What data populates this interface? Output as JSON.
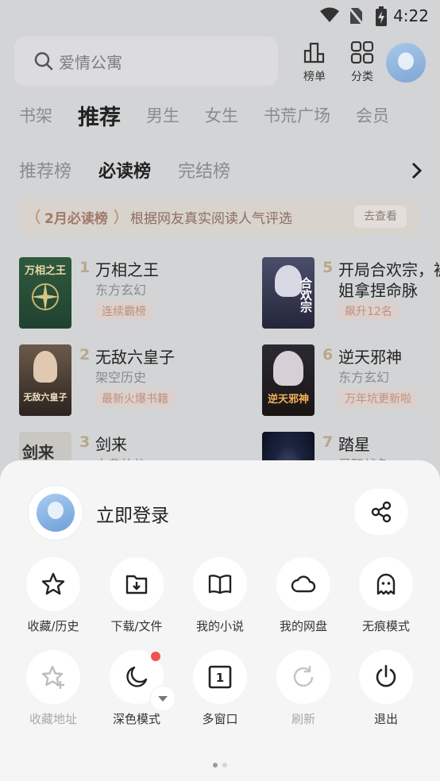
{
  "status_bar": {
    "time": "4:22"
  },
  "search": {
    "placeholder": "爱情公寓"
  },
  "top_buttons": {
    "rank_label": "榜单",
    "category_label": "分类"
  },
  "tabs": [
    "书架",
    "推荐",
    "男生",
    "女生",
    "书荒广场",
    "会员"
  ],
  "active_tab": "推荐",
  "sub_tabs": [
    "推荐榜",
    "必读榜",
    "完结榜"
  ],
  "active_sub_tab": "必读榜",
  "banner": {
    "title": "2月必读榜",
    "subtitle": "根据网友真实阅读人气评选",
    "button": "去查看"
  },
  "books": [
    {
      "rank": "1",
      "title": "万相之王",
      "category": "东方玄幻",
      "tag": "连续霸榜",
      "cover_text": "万相之王"
    },
    {
      "rank": "2",
      "title": "无敌六皇子",
      "category": "架空历史",
      "tag": "最新火爆书籍",
      "cover_text": "无敌六皇子"
    },
    {
      "rank": "3",
      "title": "剑来",
      "category": "古典仙侠",
      "tag": "",
      "cover_text": "剑来"
    },
    {
      "rank": "5",
      "title": "开局合欢宗，被",
      "title2": "姐拿捏命脉",
      "category": "",
      "tag": "飙升12名",
      "cover_text": "合欢宗"
    },
    {
      "rank": "6",
      "title": "逆天邪神",
      "category": "东方玄幻",
      "tag": "万年坑更新啦",
      "cover_text": "逆天邪神"
    },
    {
      "rank": "7",
      "title": "踏星",
      "category": "星际战争",
      "tag": "",
      "cover_text": ""
    }
  ],
  "sheet": {
    "login_label": "立即登录",
    "row1": [
      {
        "label": "收藏/历史",
        "icon": "star-icon"
      },
      {
        "label": "下载/文件",
        "icon": "download-folder-icon"
      },
      {
        "label": "我的小说",
        "icon": "book-icon"
      },
      {
        "label": "我的网盘",
        "icon": "cloud-icon"
      },
      {
        "label": "无痕模式",
        "icon": "ghost-icon"
      }
    ],
    "row2": [
      {
        "label": "收藏地址",
        "icon": "star-plus-icon"
      },
      {
        "label": "深色模式",
        "icon": "moon-icon"
      },
      {
        "label": "多窗口",
        "icon": "window-count-icon",
        "window_count": "1"
      },
      {
        "label": "刷新",
        "icon": "refresh-icon"
      },
      {
        "label": "退出",
        "icon": "power-icon"
      }
    ]
  },
  "colors": {
    "accent_red": "#ef5350",
    "sheet_bg": "#f5f5f5"
  }
}
